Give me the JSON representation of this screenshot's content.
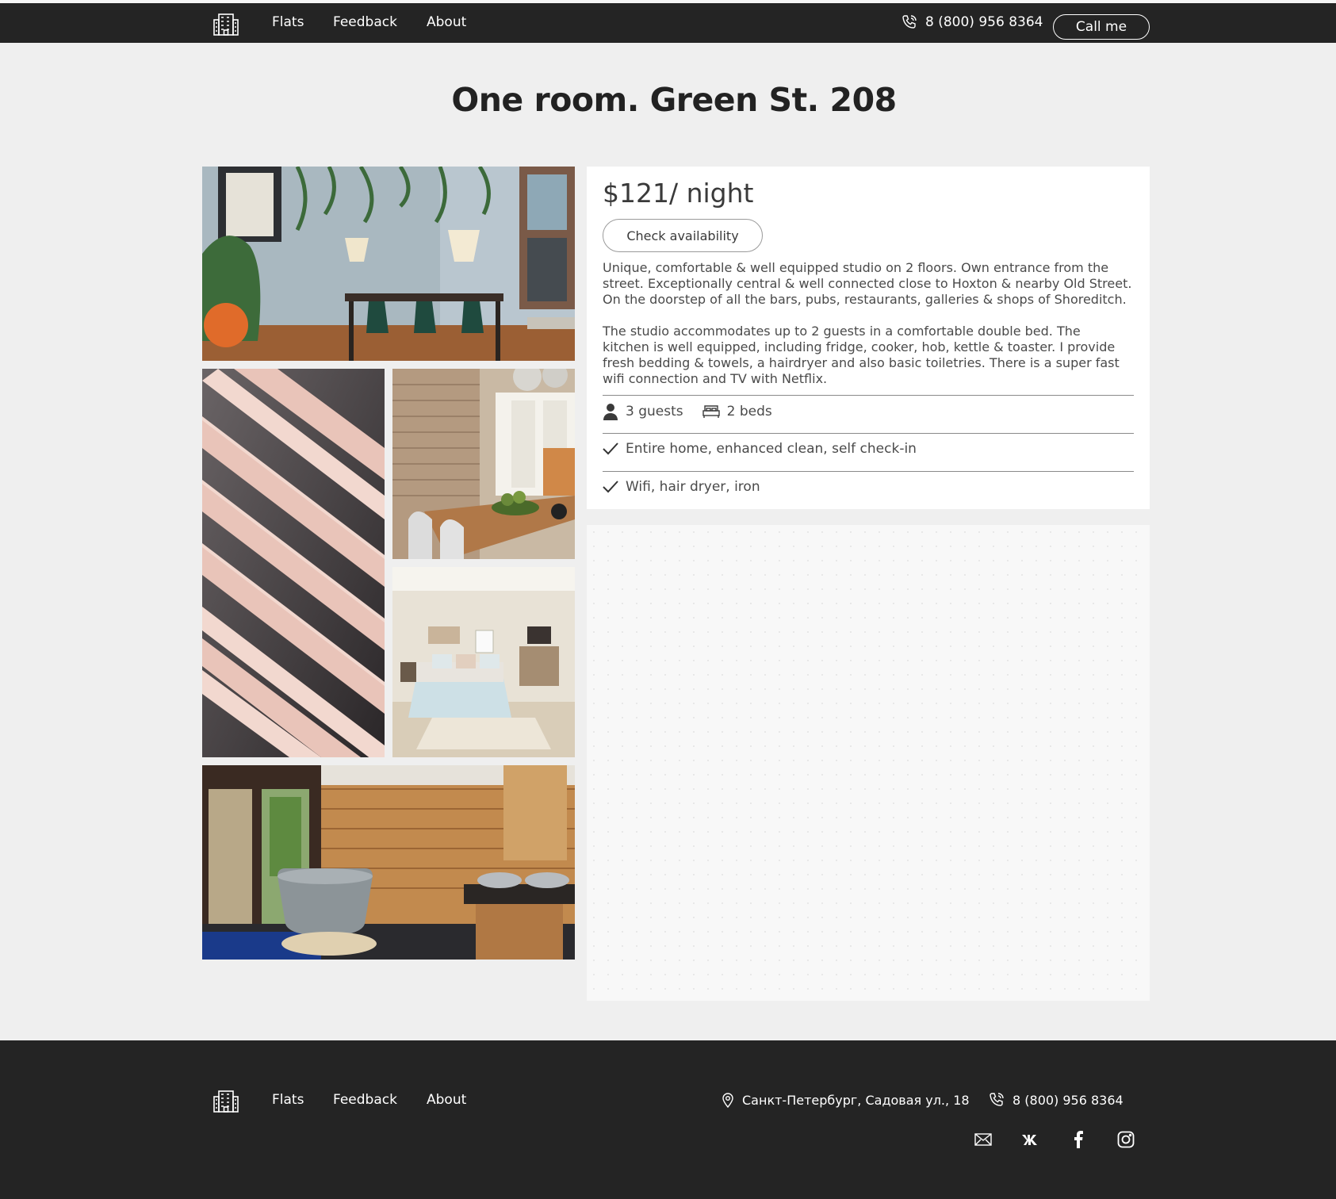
{
  "header": {
    "nav": [
      "Flats",
      "Feedback",
      "About"
    ],
    "phone": "8 (800) 956 8364",
    "call_button": "Call me"
  },
  "title": "One room. Green St. 208",
  "listing": {
    "price": "$121/ night",
    "check_button": "Check availability",
    "desc_p1": [
      "Unique, comfortable & well equipped studio on 2 floors. Own entrance from the",
      "street. Exceptionally central & well connected close to Hoxton & nearby Old Street.",
      "On the doorstep of all the bars, pubs, restaurants, galleries & shops of Shoreditch."
    ],
    "desc_p2": [
      "The studio accommodates up to 2 guests in a comfortable double bed. The",
      "kitchen is well equipped, including fridge, cooker, hob, kettle & toaster. I provide",
      "fresh bedding & towels, a hairdryer and also basic toiletries. There is a super fast",
      "wifi connection and TV with Netflix."
    ],
    "guests": "3 guests",
    "beds": "2 beds",
    "feature1": "Entire home, enhanced clean, self check-in",
    "feature2": "Wifi, hair dryer, iron"
  },
  "footer": {
    "nav": [
      "Flats",
      "Feedback",
      "About"
    ],
    "address": "Санкт-Петербург, Садовая ул., 18",
    "phone": "8 (800) 956 8364",
    "social": [
      "mail-icon",
      "vk-icon",
      "facebook-icon",
      "instagram-icon"
    ]
  },
  "colors": {
    "dark": "#242424",
    "bg": "#efefef",
    "text": "#3a3a3a"
  }
}
